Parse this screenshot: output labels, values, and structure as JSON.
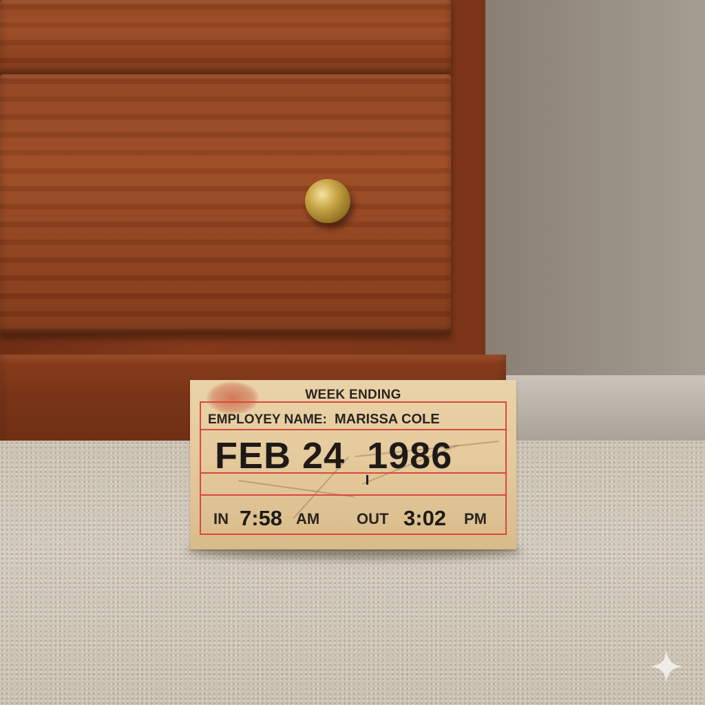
{
  "timecard": {
    "title": "WEEK ENDING",
    "employee_label": "EMPLOYEY NAME:",
    "employee_name": "MARISSA COLE",
    "date": "FEB 24  1986",
    "in_label": "IN",
    "in_time": "7:58",
    "in_meridiem": "AM",
    "out_label": "OUT",
    "out_time": "3:02",
    "out_meridiem": "PM"
  },
  "colors": {
    "card": "#e4c99b",
    "frame": "#d9473a",
    "wood": "#8e4220",
    "carpet": "#cbc2b3"
  },
  "icons": {
    "knob": "drawer-knob-icon",
    "watermark": "sparkle-icon"
  }
}
